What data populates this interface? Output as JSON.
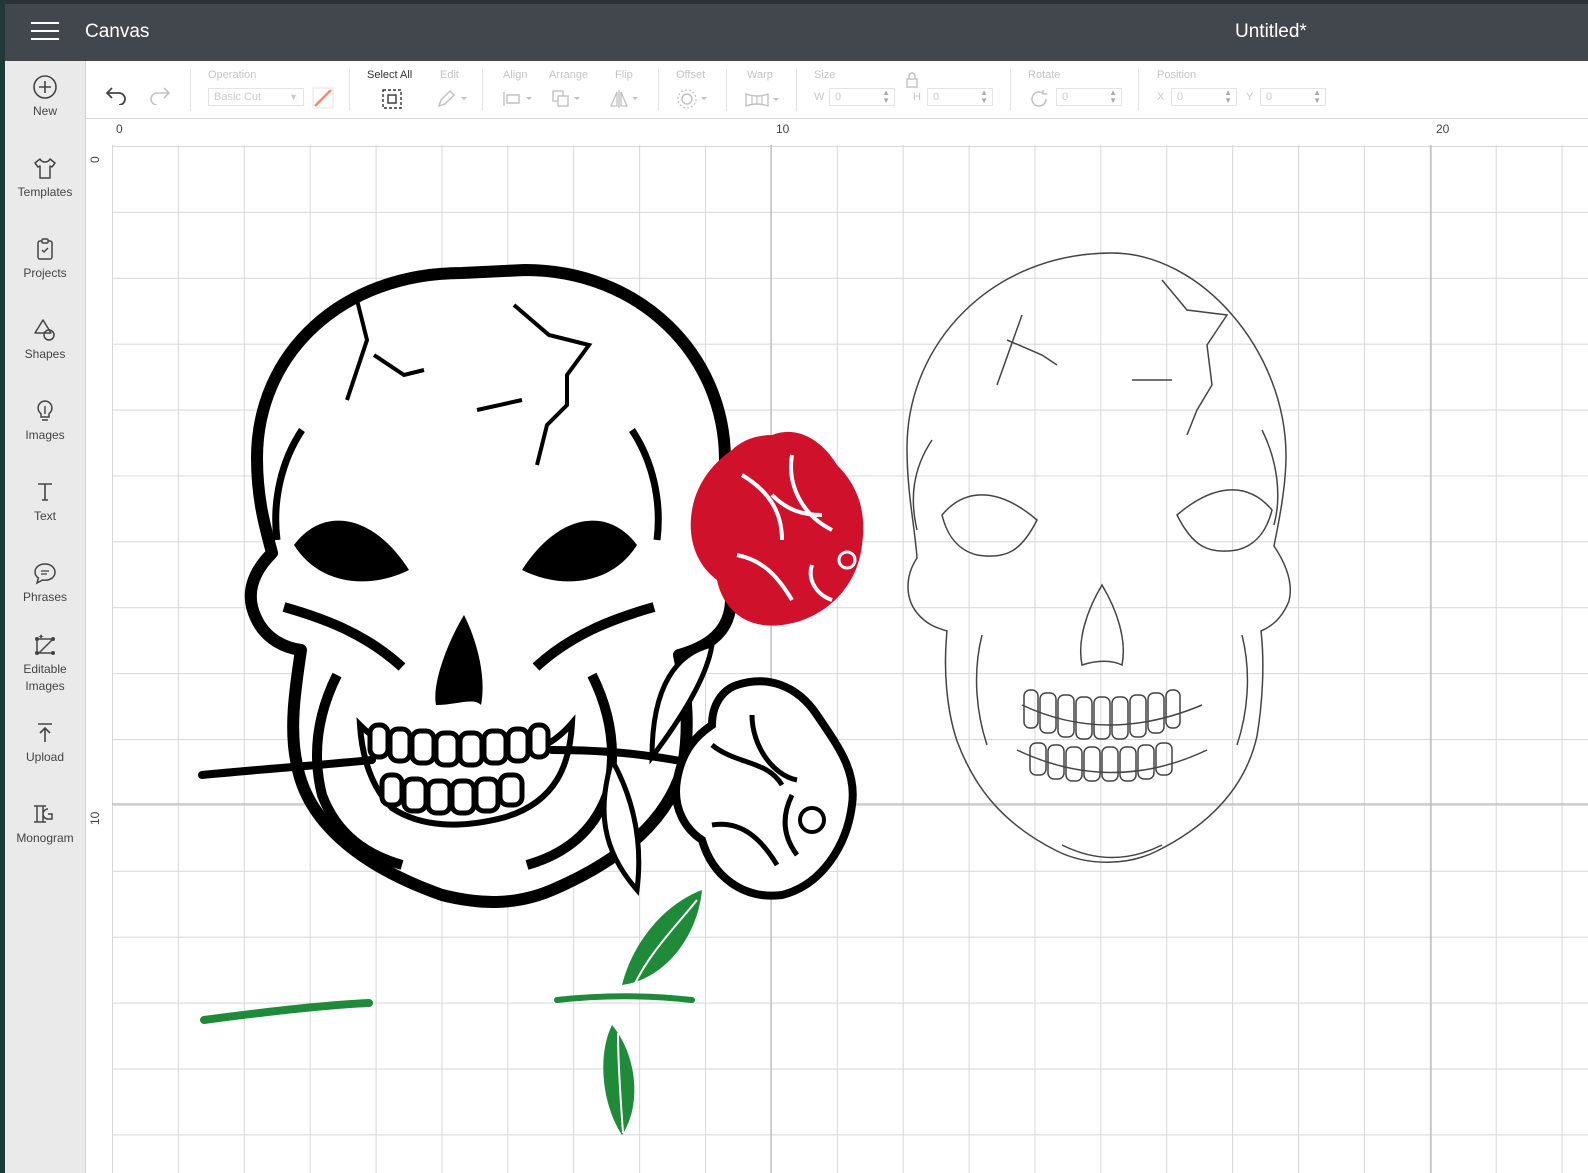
{
  "header": {
    "app_title": "Canvas",
    "doc_title": "Untitled*"
  },
  "sidebar": {
    "items": [
      {
        "label": "New",
        "icon": "plus-circle-icon"
      },
      {
        "label": "Templates",
        "icon": "tshirt-icon"
      },
      {
        "label": "Projects",
        "icon": "clipboard-icon"
      },
      {
        "label": "Shapes",
        "icon": "shapes-icon"
      },
      {
        "label": "Images",
        "icon": "lightbulb-icon"
      },
      {
        "label": "Text",
        "icon": "text-icon"
      },
      {
        "label": "Phrases",
        "icon": "speech-bubble-icon"
      },
      {
        "label": "Editable Images",
        "icon": "editable-image-icon"
      },
      {
        "label": "Upload",
        "icon": "upload-icon"
      },
      {
        "label": "Monogram",
        "icon": "monogram-icon"
      }
    ]
  },
  "toolbar": {
    "operation_label": "Operation",
    "operation_value": "Basic Cut",
    "select_all_label": "Select All",
    "edit_label": "Edit",
    "align_label": "Align",
    "arrange_label": "Arrange",
    "flip_label": "Flip",
    "offset_label": "Offset",
    "warp_label": "Warp",
    "size_label": "Size",
    "w_label": "W",
    "w_value": "0",
    "h_label": "H",
    "h_value": "0",
    "rotate_label": "Rotate",
    "rotate_value": "0",
    "position_label": "Position",
    "x_label": "X",
    "x_value": "0",
    "y_label": "Y",
    "y_value": "0"
  },
  "rulers": {
    "top": [
      "0",
      "10",
      "20"
    ],
    "left": [
      "0",
      "10"
    ]
  },
  "canvas_objects": [
    {
      "name": "black skull with rose",
      "color": "#000000"
    },
    {
      "name": "red rose layer",
      "color": "#d0112b"
    },
    {
      "name": "outline skull",
      "color": "#555555"
    },
    {
      "name": "green stems and leaves",
      "color": "#1e8a3a"
    }
  ]
}
